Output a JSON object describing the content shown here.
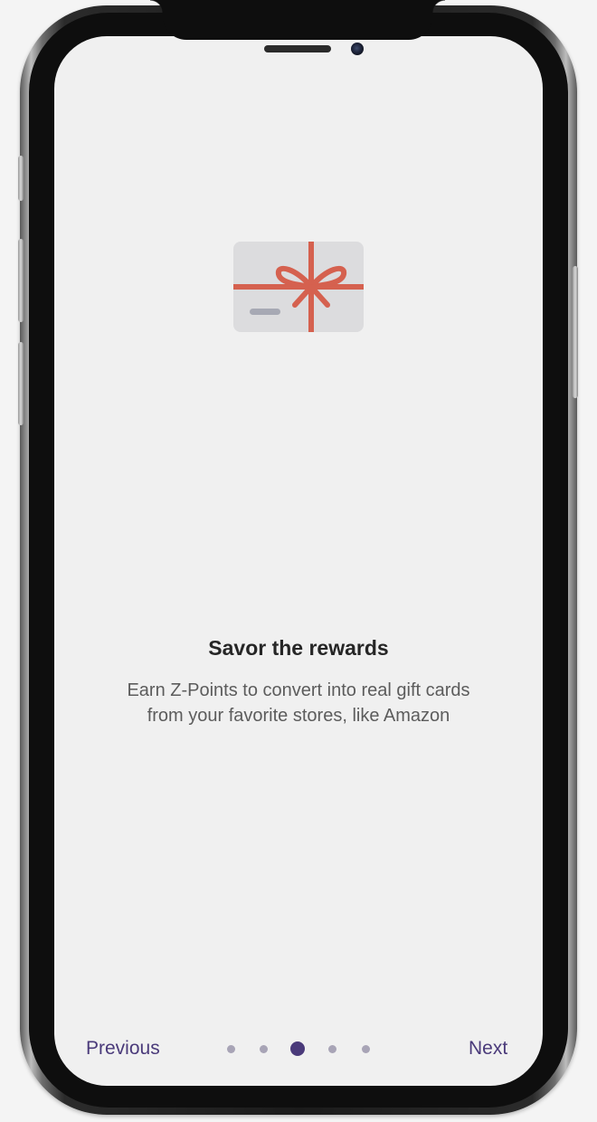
{
  "onboarding": {
    "title": "Savor the rewards",
    "description_line1": "Earn Z-Points to convert into real gift cards",
    "description_line2": "from your favorite stores, like Amazon",
    "illustration_icon": "gift-card-icon"
  },
  "navigation": {
    "previous_label": "Previous",
    "next_label": "Next",
    "page_count": 5,
    "current_page": 3
  },
  "colors": {
    "screen_background": "#f0f0f0",
    "accent": "#4a3a7a",
    "ribbon": "#d5614f",
    "card": "#dcdcde",
    "inactive_dot": "#a8a4b6"
  }
}
